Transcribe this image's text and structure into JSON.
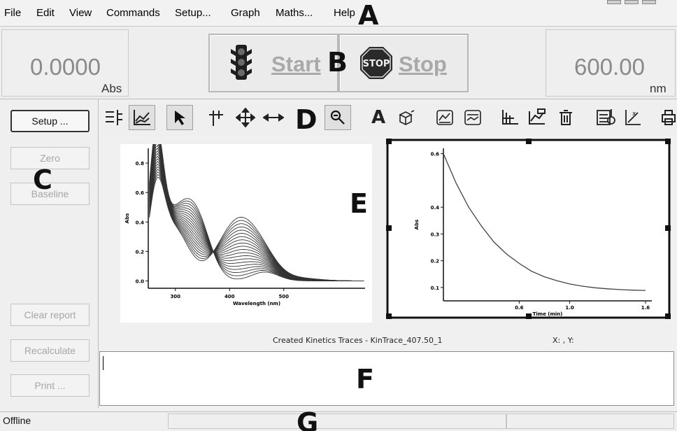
{
  "menu": {
    "items": [
      {
        "label": "File"
      },
      {
        "label": "Edit"
      },
      {
        "label": "View"
      },
      {
        "label": "Commands"
      },
      {
        "label": "Setup..."
      },
      {
        "label": "Graph"
      },
      {
        "label": "Maths..."
      },
      {
        "label": "Help"
      }
    ]
  },
  "readout": {
    "absorbance_value": "0.0000",
    "absorbance_unit": "Abs",
    "wavelength_value": "600.00",
    "wavelength_unit": "nm"
  },
  "controls": {
    "start_label": "Start",
    "stop_label": "Stop",
    "stop_sign_text": "STOP"
  },
  "commands": {
    "setup_label": "Setup ...",
    "zero_label": "Zero",
    "baseline_label": "Baseline",
    "clear_report_label": "Clear report",
    "recalculate_label": "Recalculate",
    "print_label": "Print ..."
  },
  "toolbar": {
    "icons": [
      "list-icon",
      "graph-mode-icon",
      "pointer-icon",
      "crosshair-icon",
      "move-icon",
      "horizontal-move-icon",
      "zoom-icon",
      "text-icon",
      "3d-box-icon",
      "graph-properties-icon",
      "graph-format-icon",
      "axes-icon",
      "overlay-icon",
      "delete-icon",
      "data-table-icon",
      "scale-icon",
      "printer-icon"
    ]
  },
  "graph": {
    "caption": "Created Kinetics Traces - KinTrace_407.50_1",
    "coords_readout": "X: , Y:"
  },
  "chart_data": [
    {
      "type": "line",
      "xlabel": "Wavelength (nm)",
      "ylabel": "Abs",
      "xlim": [
        250,
        650
      ],
      "ylim": [
        -0.05,
        0.9
      ],
      "xticks": [
        "300",
        "400",
        "500"
      ],
      "yticks": [
        "0.0",
        "0.2",
        "0.4",
        "0.6",
        "0.8"
      ],
      "series_count": 20,
      "annotation": "multiple overlaid spectra; isosbestic point near 310 nm"
    },
    {
      "type": "line",
      "xlabel": "Time (min)",
      "ylabel": "Abs",
      "xlim": [
        0,
        1.65
      ],
      "ylim": [
        0.05,
        0.62
      ],
      "xticks": [
        "0.6",
        "1.0",
        "1.6"
      ],
      "yticks": [
        "0.1",
        "0.2",
        "0.3",
        "0.4",
        "0.6"
      ],
      "x": [
        0.0,
        0.1,
        0.2,
        0.3,
        0.4,
        0.5,
        0.6,
        0.7,
        0.8,
        0.9,
        1.0,
        1.1,
        1.2,
        1.3,
        1.4,
        1.5,
        1.6
      ],
      "y": [
        0.6,
        0.49,
        0.4,
        0.33,
        0.27,
        0.225,
        0.19,
        0.16,
        0.14,
        0.125,
        0.113,
        0.105,
        0.099,
        0.095,
        0.092,
        0.09,
        0.089
      ]
    }
  ],
  "status": {
    "state": "Offline"
  },
  "callouts": {
    "a": "A",
    "b": "B",
    "c": "C",
    "d": "D",
    "e": "E",
    "f": "F",
    "g": "G"
  }
}
